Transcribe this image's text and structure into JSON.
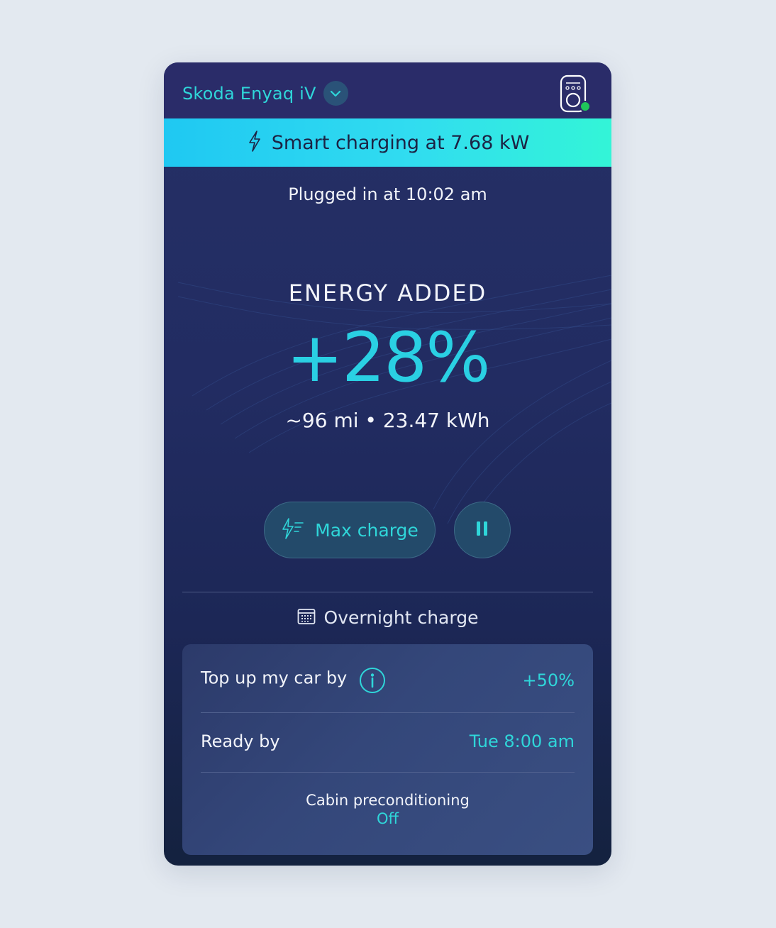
{
  "header": {
    "vehicle_name": "Skoda Enyaq iV",
    "dropdown_icon": "chevron-down-icon",
    "charger_icon": "charger-icon",
    "charger_status_color": "#20c65a"
  },
  "banner": {
    "icon": "lightning-icon",
    "text": "Smart charging at 7.68 kW"
  },
  "status": {
    "plugged_in": "Plugged in at 10:02 am"
  },
  "energy": {
    "label": "ENERGY ADDED",
    "value": "+28%",
    "detail": "~96 mi • 23.47 kWh"
  },
  "actions": {
    "max_charge_label": "Max charge",
    "max_charge_icon": "boost-icon",
    "pause_icon": "pause-icon"
  },
  "schedule": {
    "title": "Overnight charge",
    "icon": "calendar-icon",
    "top_up_label": "Top up my car by",
    "top_up_value": "+50%",
    "ready_by_label": "Ready by",
    "ready_by_value": "Tue 8:00 am",
    "cabin_label": "Cabin preconditioning",
    "cabin_value": "Off"
  },
  "colors": {
    "accent": "#2fd6d9",
    "banner_start": "#1fc8f2",
    "banner_end": "#33f5d7",
    "card_bg": "#222c62"
  }
}
